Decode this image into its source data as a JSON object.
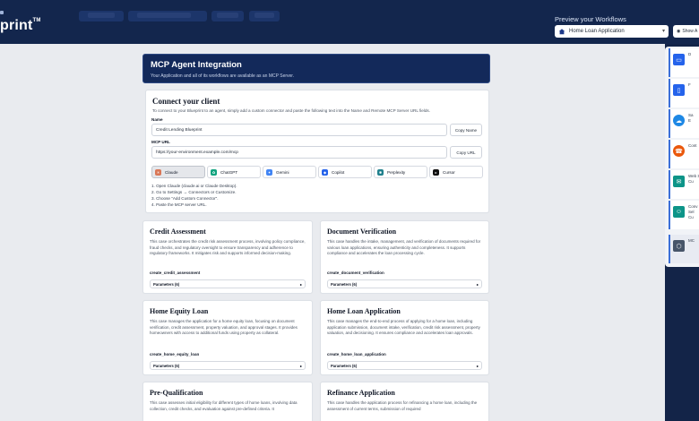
{
  "brand": {
    "name": "print",
    "mark": "TM"
  },
  "preview": {
    "label": "Preview your Workflows",
    "selected": "Home Loan Application",
    "show_label": "Show A"
  },
  "right_panel": {
    "items": [
      {
        "label": "D",
        "icon": "monitor-icon",
        "color": "#2563eb"
      },
      {
        "label": "F",
        "icon": "tablet-icon",
        "color": "#2563eb"
      },
      {
        "label": "Sa\nE",
        "icon": "salesforce-icon",
        "color": "#1e88e5"
      },
      {
        "label": "Cont",
        "icon": "headset-icon",
        "color": "#ea580c"
      },
      {
        "label": "Web S\nCu",
        "icon": "chat-icon",
        "color": "#0d9488"
      },
      {
        "label": "Conv\nSel\nCu",
        "icon": "agent-icon",
        "color": "#0d9488"
      },
      {
        "label": "MC",
        "icon": "mcp-icon",
        "color": "#475569"
      }
    ]
  },
  "header": {
    "title": "MCP Agent Integration",
    "subtitle": "Your Application and all of its workflows are available as an MCP Server."
  },
  "connect": {
    "title": "Connect your client",
    "description": "To connect to your Blueprint to an agent, simply add a custom connector and paste the following text into the Name and Remote MCP Server URL fields.",
    "name_label": "Name",
    "name_value": "Credit Lending Blueprint",
    "copy_name": "Copy Name",
    "url_label": "MCP URL",
    "url_value": "https://your-environment.example.com/mcp",
    "copy_url": "Copy URL",
    "clients": [
      {
        "label": "Claude",
        "icon": "claude-icon",
        "color": "#d97757",
        "active": true
      },
      {
        "label": "ChatGPT",
        "icon": "chatgpt-icon",
        "color": "#10a37f",
        "active": false
      },
      {
        "label": "Gemini",
        "icon": "gemini-icon",
        "color": "#4285f4",
        "active": false
      },
      {
        "label": "Copilot",
        "icon": "copilot-icon",
        "color": "#2563eb",
        "active": false
      },
      {
        "label": "Perplexity",
        "icon": "perplexity-icon",
        "color": "#20808d",
        "active": false
      },
      {
        "label": "Cursor",
        "icon": "cursor-icon",
        "color": "#111111",
        "active": false
      }
    ],
    "steps": [
      "1. Open Claude (claude.ai or Claude Desktop).",
      "2. Go to Settings → Connectors or Customize.",
      "3. Choose \"Add Custom Connector\".",
      "4. Paste the MCP server URL."
    ]
  },
  "workflows": [
    {
      "title": "Credit Assessment",
      "description": "This case orchestrates the credit risk assessment process, involving policy compliance, fraud checks, and regulatory oversight to ensure transparency and adherence to regulatory frameworks. It mitigates risk and supports informed decision-making.",
      "tool": "create_credit_assessment",
      "params": "Parameters (6)"
    },
    {
      "title": "Document Verification",
      "description": "This case handles the intake, management, and verification of documents required for various loan applications, ensuring authenticity and completeness. It supports compliance and accelerates the loan processing cycle.",
      "tool": "create_document_verification",
      "params": "Parameters (6)"
    },
    {
      "title": "Home Equity Loan",
      "description": "This case manages the application for a home equity loan, focusing on document verification, credit assessment, property valuation, and approval stages. It provides homeowners with access to additional funds using property as collateral.",
      "tool": "create_home_equity_loan",
      "params": "Parameters (6)"
    },
    {
      "title": "Home Loan Application",
      "description": "This case manages the end-to-end process of applying for a home loan, including application submission, document intake, verification, credit risk assessment, property valuation, and decisioning. It ensures compliance and accelerates loan approvals.",
      "tool": "create_home_loan_application",
      "params": "Parameters (6)"
    },
    {
      "title": "Pre-Qualification",
      "description": "This case assesses initial eligibility for different types of home loans, involving data collection, credit checks, and evaluation against pre-defined criteria. It",
      "tool": "",
      "params": ""
    },
    {
      "title": "Refinance Application",
      "description": "This case handles the application process for refinancing a home loan, including the assessment of current terms, submission of required",
      "tool": "",
      "params": ""
    }
  ]
}
